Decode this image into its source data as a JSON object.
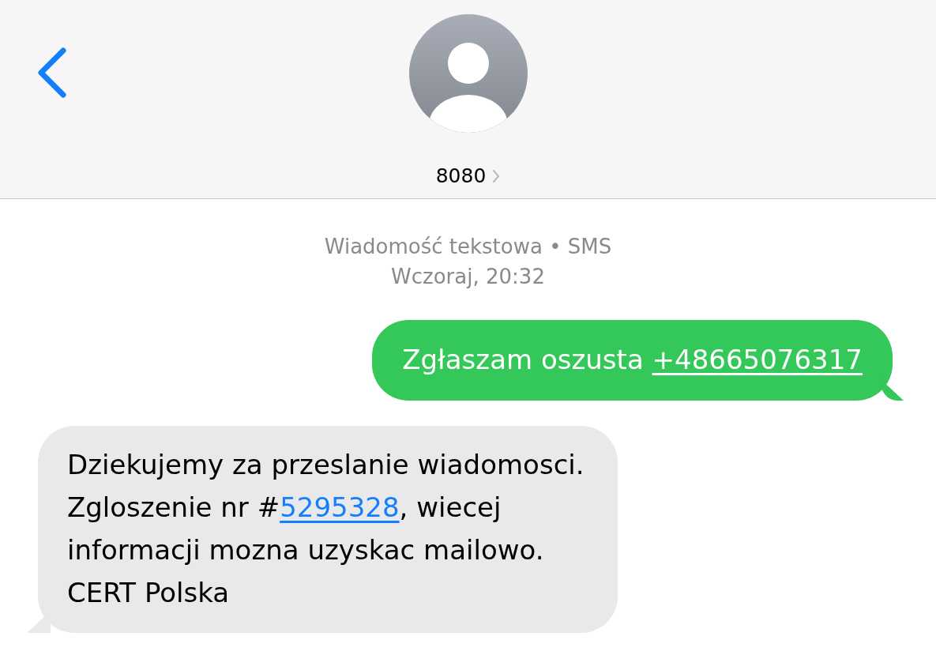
{
  "header": {
    "contact": {
      "name": "8080"
    }
  },
  "meta": [
    "Wiadomość tekstowa • SMS",
    "Wczoraj, 20:32"
  ],
  "messages": [
    {
      "kind": "sent",
      "lines": [
        [
          {
            "text": "Zgłaszam oszusta ",
            "link": false
          },
          {
            "text": "+48665076317",
            "link": true
          }
        ]
      ]
    },
    {
      "kind": "received",
      "lines": [
        [
          {
            "text": "Dziekujemy za przeslanie wiadomosci.",
            "link": false
          }
        ],
        [
          {
            "text": "Zgloszenie nr #",
            "link": false
          },
          {
            "text": "5295328",
            "link": true
          },
          {
            "text": ", wiecej",
            "link": false
          }
        ],
        [
          {
            "text": "informacji mozna uzyskac mailowo.",
            "link": false
          }
        ],
        [
          {
            "text": "CERT Polska",
            "link": false
          }
        ]
      ]
    }
  ]
}
